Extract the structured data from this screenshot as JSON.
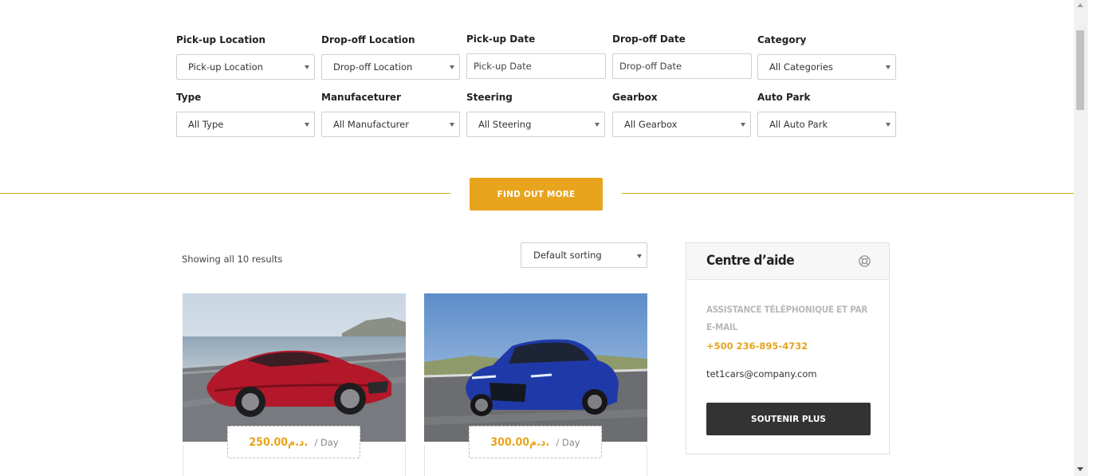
{
  "filters": {
    "row1": [
      {
        "label": "Pick-up Location",
        "value": "Pick-up Location",
        "kind": "select"
      },
      {
        "label": "Drop-off Location",
        "value": "Drop-off Location",
        "kind": "select"
      },
      {
        "label": "Pick-up Date",
        "placeholder": "Pick-up Date",
        "kind": "date"
      },
      {
        "label": "Drop-off Date",
        "placeholder": "Drop-off Date",
        "kind": "date"
      },
      {
        "label": "Category",
        "value": "All Categories",
        "kind": "select"
      }
    ],
    "row2": [
      {
        "label": "Type",
        "value": "All Type",
        "kind": "select"
      },
      {
        "label": "Manufaceturer",
        "value": "All Manufacturer",
        "kind": "select"
      },
      {
        "label": "Steering",
        "value": "All Steering",
        "kind": "select"
      },
      {
        "label": "Gearbox",
        "value": "All Gearbox",
        "kind": "select"
      },
      {
        "label": "Auto Park",
        "value": "All Auto Park",
        "kind": "select"
      }
    ]
  },
  "find_button": "FIND OUT MORE",
  "results": {
    "count_text": "Showing all 10 results",
    "sort_value": "Default sorting"
  },
  "cars": [
    {
      "price": "250.00د.م.",
      "unit": "/ Day",
      "color": "#b3182a"
    },
    {
      "price": "300.00د.م.",
      "unit": "/ Day",
      "color": "#1f3aa8"
    }
  ],
  "help": {
    "title": "Centre d’aide",
    "subtitle": "ASSISTANCE TÉLÉPHONIQUE ET PAR E-MAIL",
    "phone": "+500 236-895-4732",
    "email": "tet1cars@company.com",
    "button": "SOUTENIR PLUS"
  },
  "colors": {
    "accent": "#e8a41c",
    "dark_button": "#333333"
  }
}
